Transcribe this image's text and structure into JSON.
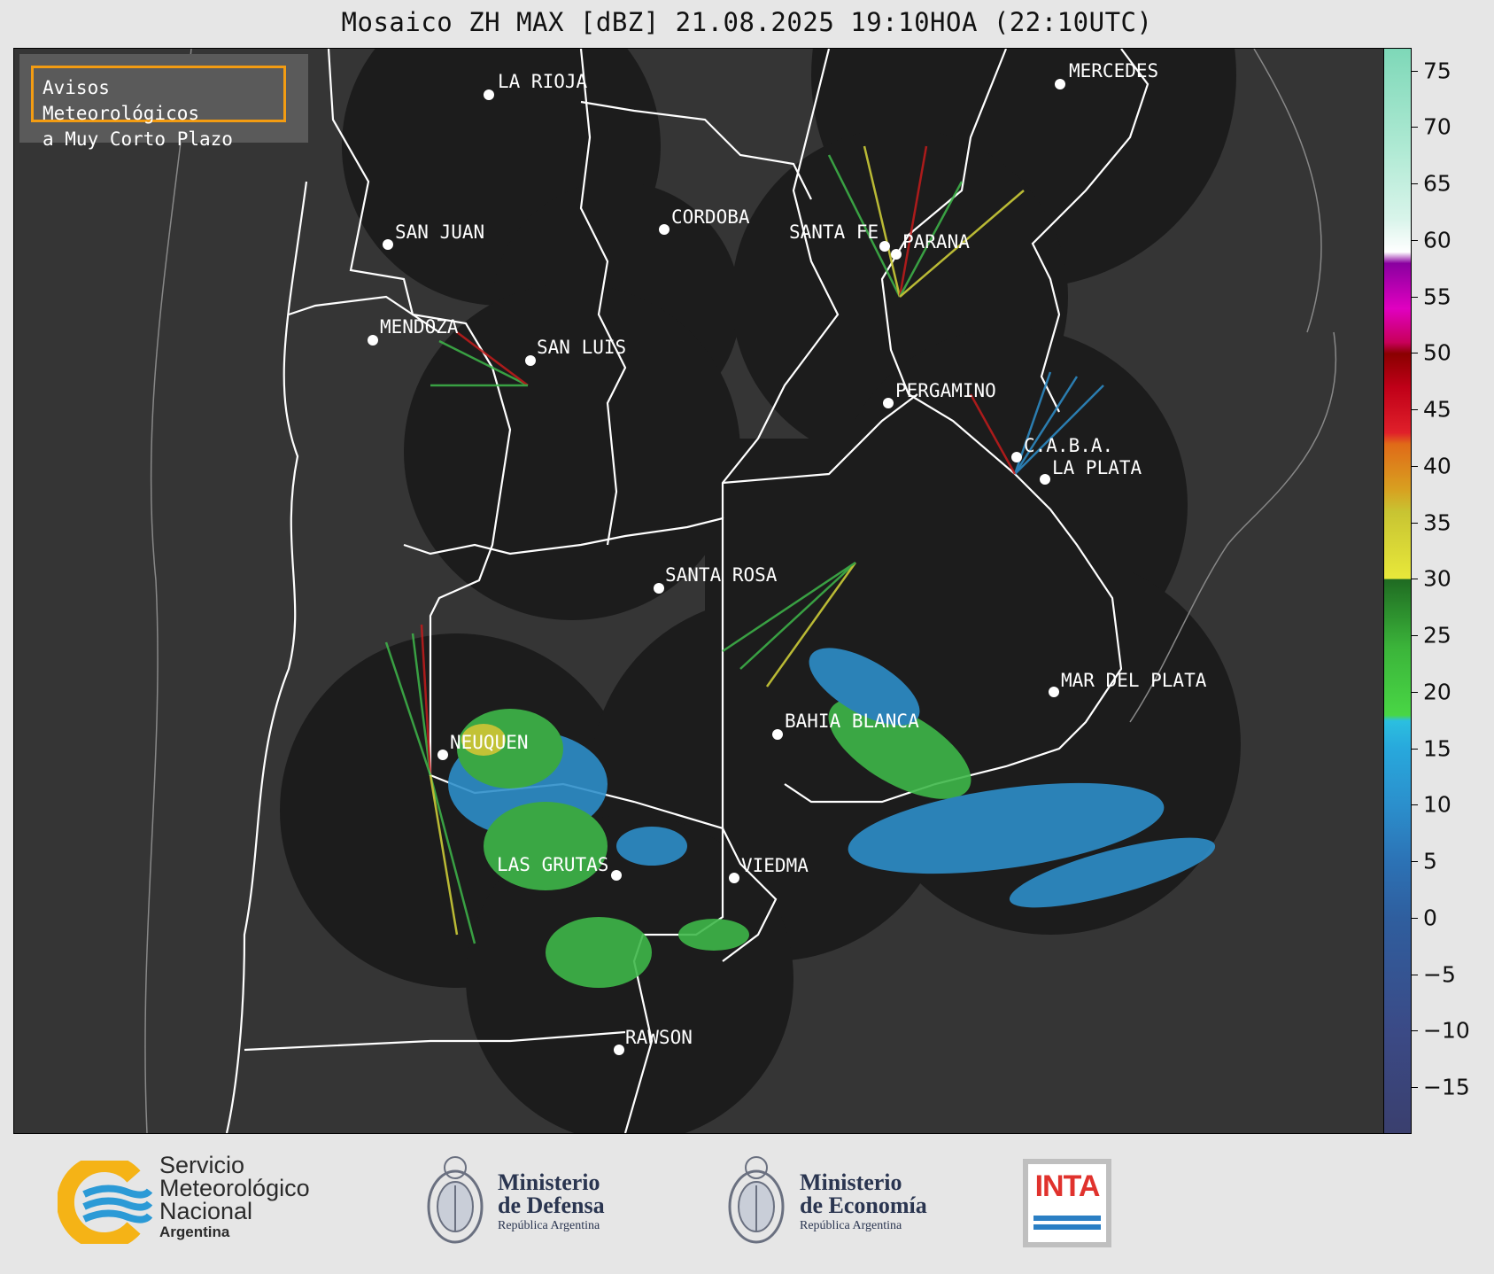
{
  "title": "Mosaico ZH MAX [dBZ] 21.08.2025 19:10HOA (22:10UTC)",
  "warning_box": {
    "line1": "Avisos Meteorológicos",
    "line2": "a Muy Corto Plazo",
    "border_color": "#f39c12"
  },
  "cities": [
    {
      "name": "LA RIOJA"
    },
    {
      "name": "MERCEDES"
    },
    {
      "name": "SAN JUAN"
    },
    {
      "name": "CORDOBA"
    },
    {
      "name": "SANTA FE"
    },
    {
      "name": "PARANA"
    },
    {
      "name": "MENDOZA"
    },
    {
      "name": "SAN LUIS"
    },
    {
      "name": "PERGAMINO"
    },
    {
      "name": "C.A.B.A."
    },
    {
      "name": "LA PLATA"
    },
    {
      "name": "SANTA ROSA"
    },
    {
      "name": "MAR DEL PLATA"
    },
    {
      "name": "BAHIA BLANCA"
    },
    {
      "name": "NEUQUEN"
    },
    {
      "name": "LAS GRUTAS"
    },
    {
      "name": "VIEDMA"
    },
    {
      "name": "RAWSON"
    }
  ],
  "colorbar": {
    "ticks": [
      "75",
      "70",
      "65",
      "60",
      "55",
      "50",
      "45",
      "40",
      "35",
      "30",
      "25",
      "20",
      "15",
      "10",
      "5",
      "0",
      "−5",
      "−10",
      "−15"
    ],
    "range": [
      -19,
      77
    ]
  },
  "colors": {
    "radar_disc": "#1c1c1c",
    "background": "#353535",
    "accent": "#f39c12"
  },
  "footer": {
    "smn": {
      "line1": "Servicio",
      "line2": "Meteorológico",
      "line3": "Nacional",
      "line4": "Argentina"
    },
    "defensa": {
      "line1": "Ministerio",
      "line2": "de Defensa",
      "line3": "República Argentina"
    },
    "economia": {
      "line1": "Ministerio",
      "line2": "de Economía",
      "line3": "República Argentina"
    },
    "inta": {
      "text": "INTA"
    }
  }
}
